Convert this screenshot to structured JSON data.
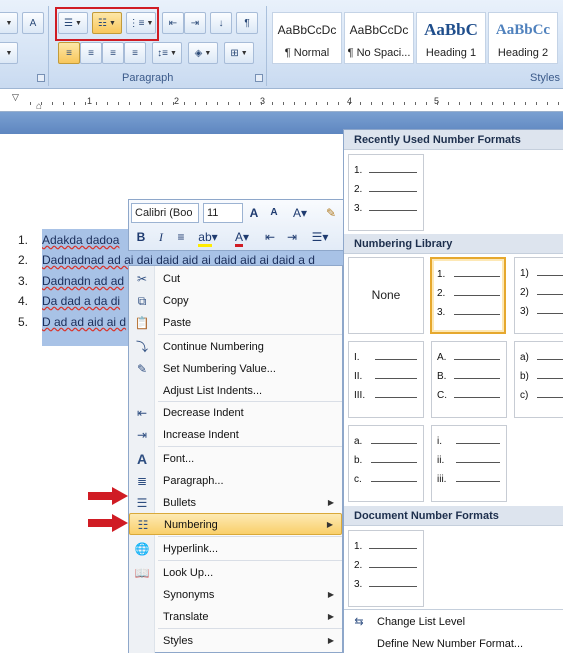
{
  "ribbon": {
    "paragraph_label": "Paragraph",
    "styles_label": "Styles",
    "styles": [
      {
        "preview": "AaBbCcDc",
        "name": "¶ Normal"
      },
      {
        "preview": "AaBbCcDc",
        "name": "¶ No Spaci..."
      },
      {
        "preview": "AaBbC",
        "name": "Heading 1"
      },
      {
        "preview": "AaBbCc",
        "name": "Heading 2"
      }
    ]
  },
  "ruler": {
    "numbers": [
      "1",
      "2",
      "3",
      "4",
      "5"
    ]
  },
  "document": {
    "list": [
      {
        "num": "1.",
        "text": "Adakda dadoa"
      },
      {
        "num": "2.",
        "text": "Dadnadnad ad ai dai daid aid ai daid aid ai daid a d"
      },
      {
        "num": "3.",
        "text": "Dadnadn ad ad"
      },
      {
        "num": "4.",
        "text": "Da dad a da di"
      },
      {
        "num": "5.",
        "text": "D ad ad aid ai d"
      }
    ]
  },
  "mini_toolbar": {
    "font": "Calibri (Boo",
    "size": "11"
  },
  "context_menu": {
    "items": [
      {
        "label": "Cut"
      },
      {
        "label": "Copy"
      },
      {
        "label": "Paste"
      },
      {
        "label": "Continue Numbering"
      },
      {
        "label": "Set Numbering Value..."
      },
      {
        "label": "Adjust List Indents..."
      },
      {
        "label": "Decrease Indent"
      },
      {
        "label": "Increase Indent"
      },
      {
        "label": "Font..."
      },
      {
        "label": "Paragraph..."
      },
      {
        "label": "Bullets"
      },
      {
        "label": "Numbering"
      },
      {
        "label": "Hyperlink..."
      },
      {
        "label": "Look Up..."
      },
      {
        "label": "Synonyms"
      },
      {
        "label": "Translate"
      },
      {
        "label": "Styles"
      }
    ]
  },
  "gallery": {
    "recent_header": "Recently Used Number Formats",
    "library_header": "Numbering Library",
    "document_header": "Document Number Formats",
    "none_label": "None",
    "recent_markers": [
      "1.",
      "2.",
      "3."
    ],
    "library": [
      [
        "1.",
        "2.",
        "3."
      ],
      [
        "1)",
        "2)",
        "3)"
      ],
      [
        "I.",
        "II.",
        "III."
      ],
      [
        "A.",
        "B.",
        "C."
      ],
      [
        "a)",
        "b)",
        "c)"
      ],
      [
        "a.",
        "b.",
        "c."
      ],
      [
        "i.",
        "ii.",
        "iii."
      ]
    ],
    "document_markers": [
      "1.",
      "2.",
      "3."
    ],
    "change_level": "Change List Level",
    "define_new": "Define New Number Format..."
  },
  "colors": {
    "selection": "#a8c2e6",
    "highlight": "#f9cf6a",
    "red_callout": "#d01c24"
  }
}
